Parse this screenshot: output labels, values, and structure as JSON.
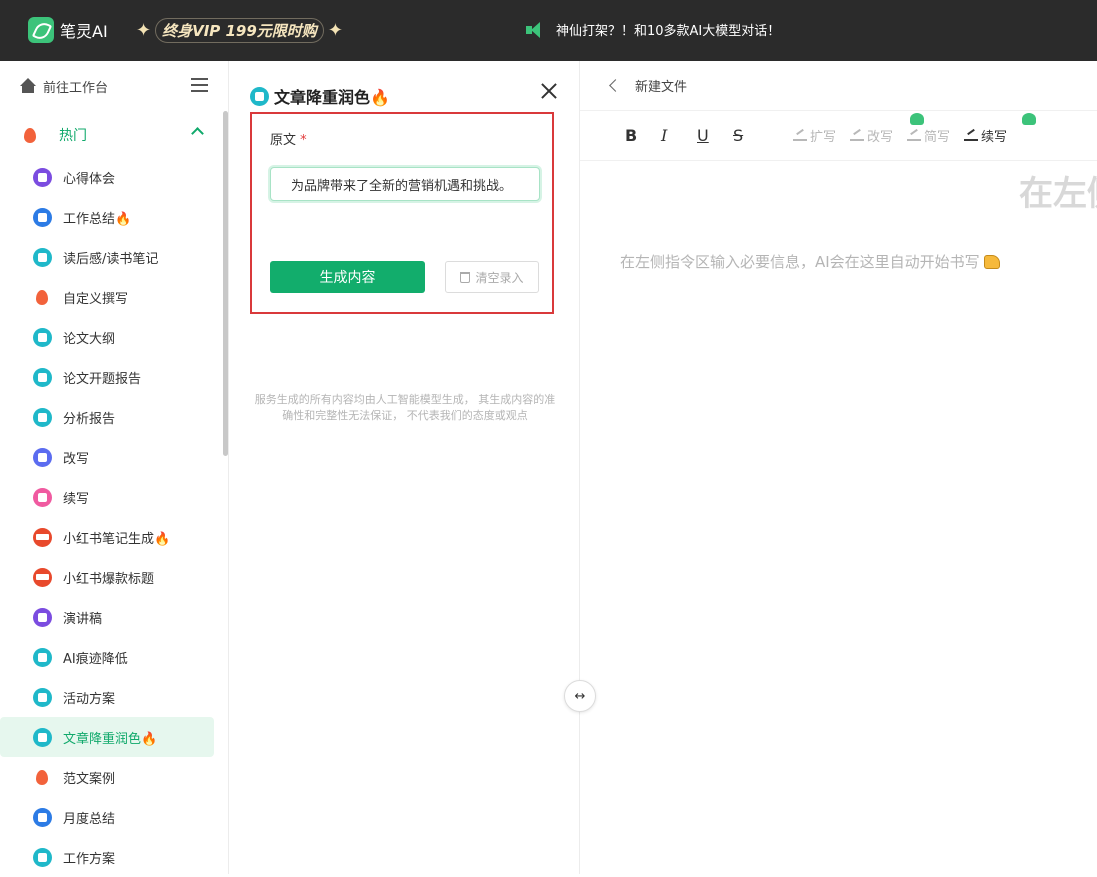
{
  "header": {
    "logo_text": "笔灵AI",
    "vip_text": "终身VIP 199元限时购",
    "announcement": "神仙打架？！和10多款AI大模型对话！"
  },
  "sidebar": {
    "goto_workbench": "前往工作台",
    "hot_label": "热门",
    "items": [
      {
        "label": "心得体会",
        "color": "#7b4ce0"
      },
      {
        "label": "工作总结🔥",
        "color": "#2c7be5"
      },
      {
        "label": "读后感/读书笔记",
        "color": "#1fb8c9"
      },
      {
        "label": "自定义撰写",
        "color": "#f2623b"
      },
      {
        "label": "论文大纲",
        "color": "#1fb8c9"
      },
      {
        "label": "论文开题报告",
        "color": "#1fb8c9"
      },
      {
        "label": "分析报告",
        "color": "#1fb8c9"
      },
      {
        "label": "改写",
        "color": "#5b6cf0"
      },
      {
        "label": "续写",
        "color": "#f05aa0"
      },
      {
        "label": "小红书笔记生成🔥",
        "color": "#e8492c"
      },
      {
        "label": "小红书爆款标题",
        "color": "#e8492c"
      },
      {
        "label": "演讲稿",
        "color": "#7b4ce0"
      },
      {
        "label": "AI痕迹降低",
        "color": "#1fb8c9"
      },
      {
        "label": "活动方案",
        "color": "#1fb8c9"
      },
      {
        "label": "文章降重润色🔥",
        "color": "#1fb8c9",
        "active": true
      },
      {
        "label": "范文案例",
        "color": "#f2623b"
      },
      {
        "label": "月度总结",
        "color": "#2c7be5"
      },
      {
        "label": "工作方案",
        "color": "#1fb8c9"
      }
    ]
  },
  "panel": {
    "title": "文章降重润色🔥",
    "field_label": "原文",
    "required_mark": "*",
    "input_value": "为品牌带来了全新的营销机遇和挑战。",
    "generate_button": "生成内容",
    "clear_button": "清空录入",
    "disclaimer": "服务生成的所有内容均由人工智能模型生成， 其生成内容的准确性和完整性无法保证， 不代表我们的态度或观点"
  },
  "editor": {
    "doc_name": "新建文件",
    "toolbar": {
      "bold": "B",
      "italic": "I",
      "underline": "U",
      "strike": "S",
      "expand": "扩写",
      "rewrite": "改写",
      "shorten": "简写",
      "continue": "续写"
    },
    "big_placeholder": "在左侧",
    "placeholder": "在左侧指令区输入必要信息，AI会在这里自动开始书写"
  },
  "colors": {
    "accent": "#12ad6c",
    "topbar": "#2b2b2b",
    "highlight_box": "#d9393b"
  }
}
